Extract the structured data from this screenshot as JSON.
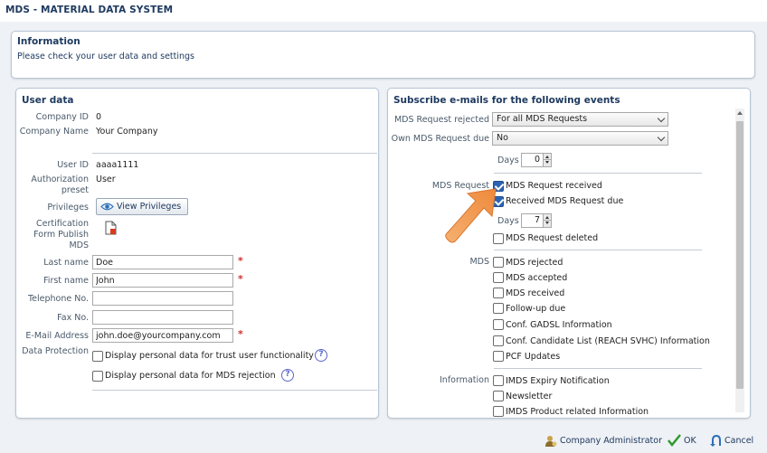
{
  "app": {
    "title": "MDS - MATERIAL DATA SYSTEM"
  },
  "info": {
    "heading": "Information",
    "text": "Please check your user data and settings"
  },
  "user_data": {
    "heading": "User data",
    "company_id_label": "Company ID",
    "company_id": "0",
    "company_name_label": "Company Name",
    "company_name": "Your Company",
    "user_id_label": "User ID",
    "user_id": "aaaa1111",
    "auth_preset_label": "Authorization preset",
    "auth_preset": "User",
    "privileges_label": "Privileges",
    "view_privileges": "View Privileges",
    "cert_label": "Certification Form Publish MDS",
    "last_name_label": "Last name",
    "last_name": "Doe",
    "first_name_label": "First name",
    "first_name": "John",
    "telephone_label": "Telephone No.",
    "telephone": "",
    "fax_label": "Fax No.",
    "fax": "",
    "email_label": "E-Mail Address",
    "email": "john.doe@yourcompany.com",
    "data_protection_label": "Data Protection",
    "dp_option1": "Display personal data for trust user functionality",
    "dp_option2": "Display personal data for MDS rejection",
    "required_mark": "*",
    "help": "?"
  },
  "subscribe": {
    "heading": "Subscribe e-mails for the following events",
    "mds_request_rejected_label": "MDS Request rejected",
    "mds_request_rejected_value": "For all MDS Requests",
    "own_request_due_label": "Own MDS Request due",
    "own_request_due_value": "No",
    "days_label": "Days",
    "days_value_1": "0",
    "days_value_2": "7",
    "mds_request_group": "MDS Request",
    "mds_request_items": [
      "MDS Request received",
      "Received MDS Request due",
      "MDS Request deleted"
    ],
    "mds_request_checked": [
      true,
      true,
      false
    ],
    "mds_group": "MDS",
    "mds_items": [
      "MDS rejected",
      "MDS accepted",
      "MDS received",
      "Follow-up due",
      "Conf. GADSL Information",
      "Conf. Candidate List (REACH SVHC) Information",
      "PCF Updates"
    ],
    "information_group": "Information",
    "information_items": [
      "IMDS Expiry Notification",
      "Newsletter",
      "IMDS Product related Information"
    ]
  },
  "footer": {
    "company_admin": "Company Administrator",
    "ok": "OK",
    "cancel": "Cancel"
  },
  "colors": {
    "accent": "#1f3a60",
    "arrow": "#f0a050",
    "check": "#2b64b4"
  }
}
